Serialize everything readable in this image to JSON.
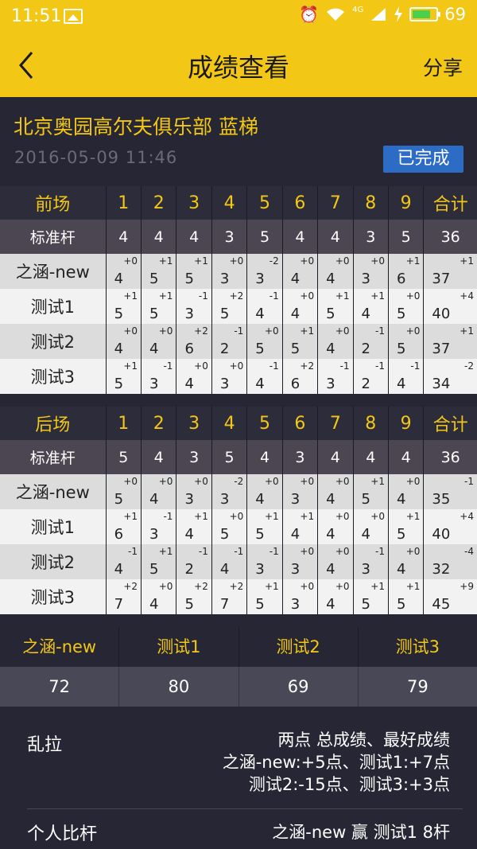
{
  "status": {
    "time": "11:51",
    "network": "4G",
    "battery": "69"
  },
  "nav": {
    "title": "成绩查看",
    "share": "分享"
  },
  "club": {
    "name": "北京奥园高尔夫俱乐部  蓝梯",
    "datetime": "2016-05-09  11:46",
    "status": "已完成"
  },
  "front": {
    "label": "前场",
    "holes": [
      "1",
      "2",
      "3",
      "4",
      "5",
      "6",
      "7",
      "8",
      "9"
    ],
    "total_label": "合计",
    "par_label": "标准杆",
    "par": [
      "4",
      "4",
      "4",
      "3",
      "5",
      "4",
      "4",
      "3",
      "5",
      "36"
    ],
    "players": [
      {
        "name": "之涵-new",
        "scores": [
          "4",
          "5",
          "5",
          "3",
          "3",
          "4",
          "4",
          "3",
          "6",
          "37"
        ],
        "diffs": [
          "+0",
          "+1",
          "+1",
          "+0",
          "-2",
          "+0",
          "+0",
          "+0",
          "+1",
          "+1"
        ]
      },
      {
        "name": "测试1",
        "scores": [
          "5",
          "5",
          "3",
          "5",
          "4",
          "4",
          "5",
          "4",
          "5",
          "40"
        ],
        "diffs": [
          "+1",
          "+1",
          "-1",
          "+2",
          "-1",
          "+0",
          "+1",
          "+1",
          "+0",
          "+4"
        ]
      },
      {
        "name": "测试2",
        "scores": [
          "4",
          "4",
          "6",
          "2",
          "5",
          "5",
          "4",
          "2",
          "5",
          "37"
        ],
        "diffs": [
          "+0",
          "+0",
          "+2",
          "-1",
          "+0",
          "+1",
          "+0",
          "-1",
          "+0",
          "+1"
        ]
      },
      {
        "name": "测试3",
        "scores": [
          "5",
          "3",
          "4",
          "3",
          "4",
          "6",
          "3",
          "2",
          "4",
          "34"
        ],
        "diffs": [
          "+1",
          "-1",
          "+0",
          "+0",
          "-1",
          "+2",
          "-1",
          "-1",
          "-1",
          "-2"
        ]
      }
    ]
  },
  "back": {
    "label": "后场",
    "holes": [
      "1",
      "2",
      "3",
      "4",
      "5",
      "6",
      "7",
      "8",
      "9"
    ],
    "total_label": "合计",
    "par_label": "标准杆",
    "par": [
      "5",
      "4",
      "3",
      "5",
      "4",
      "3",
      "4",
      "4",
      "4",
      "36"
    ],
    "players": [
      {
        "name": "之涵-new",
        "scores": [
          "5",
          "4",
          "3",
          "3",
          "4",
          "3",
          "4",
          "5",
          "4",
          "35"
        ],
        "diffs": [
          "+0",
          "+0",
          "+0",
          "-2",
          "+0",
          "+0",
          "+0",
          "+1",
          "+0",
          "-1"
        ]
      },
      {
        "name": "测试1",
        "scores": [
          "6",
          "3",
          "4",
          "5",
          "5",
          "4",
          "4",
          "4",
          "5",
          "40"
        ],
        "diffs": [
          "+1",
          "-1",
          "+1",
          "+0",
          "+1",
          "+1",
          "+0",
          "+0",
          "+1",
          "+4"
        ]
      },
      {
        "name": "测试2",
        "scores": [
          "4",
          "5",
          "2",
          "4",
          "3",
          "3",
          "4",
          "3",
          "4",
          "32"
        ],
        "diffs": [
          "-1",
          "+1",
          "-1",
          "-1",
          "-1",
          "+0",
          "+0",
          "-1",
          "+0",
          "-4"
        ]
      },
      {
        "name": "测试3",
        "scores": [
          "7",
          "4",
          "5",
          "7",
          "5",
          "3",
          "4",
          "5",
          "5",
          "45"
        ],
        "diffs": [
          "+2",
          "+0",
          "+2",
          "+2",
          "+1",
          "+0",
          "+0",
          "+1",
          "+1",
          "+9"
        ]
      }
    ]
  },
  "totals": [
    {
      "name": "之涵-new",
      "score": "72"
    },
    {
      "name": "测试1",
      "score": "80"
    },
    {
      "name": "测试2",
      "score": "69"
    },
    {
      "name": "测试3",
      "score": "79"
    }
  ],
  "bets": {
    "lala_label": "乱拉",
    "lala_lines": [
      "两点  总成绩、最好成绩",
      "之涵-new:+5点、测试1:+7点",
      "测试2:-15点、测试3:+3点"
    ],
    "match_label": "个人比杆",
    "match_text": "之涵-new  赢  测试1  8杆"
  }
}
